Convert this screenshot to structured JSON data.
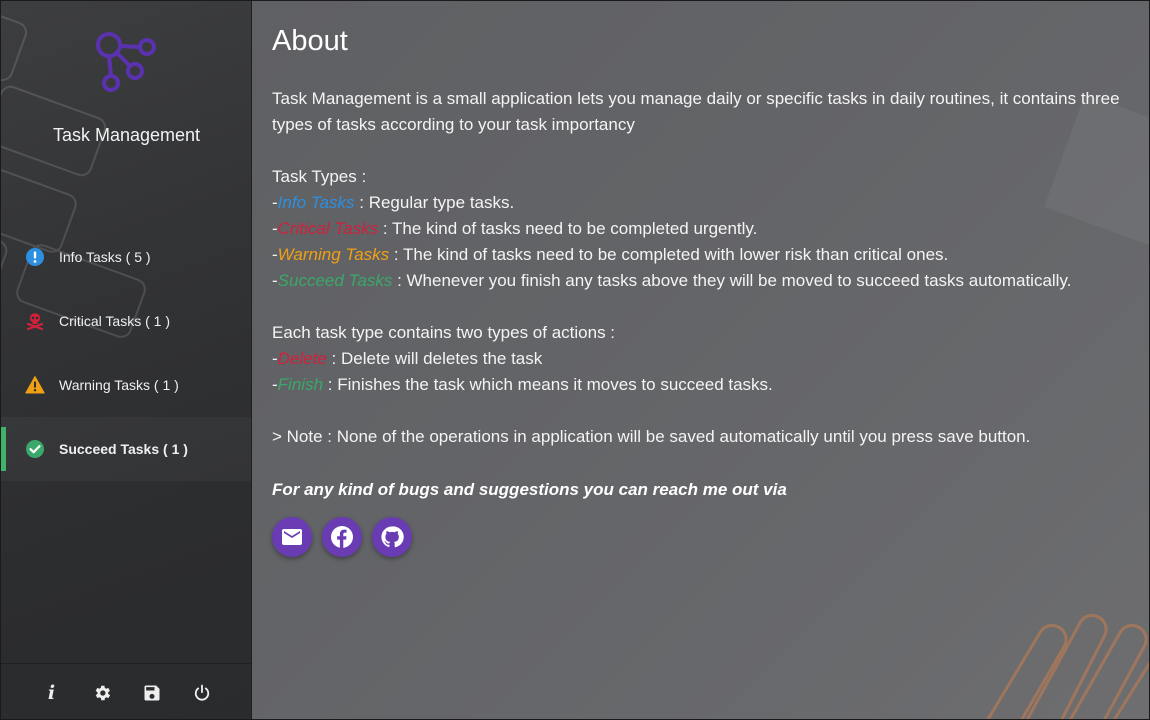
{
  "app": {
    "title": "Task Management"
  },
  "nav": {
    "items": [
      {
        "label": "Info Tasks ( 5 )",
        "icon": "info-circle-icon",
        "color": "#2d8fe0",
        "active": false
      },
      {
        "label": "Critical Tasks ( 1 )",
        "icon": "skull-crossbones-icon",
        "color": "#d0213d",
        "active": false
      },
      {
        "label": "Warning Tasks ( 1 )",
        "icon": "warning-triangle-icon",
        "color": "#f0a015",
        "active": false
      },
      {
        "label": "Succeed Tasks ( 1 )",
        "icon": "check-circle-icon",
        "color": "#3aa86a",
        "active": true
      }
    ]
  },
  "footer": {
    "buttons": [
      {
        "name": "about",
        "icon": "info-italic-icon",
        "glyph": "i"
      },
      {
        "name": "settings",
        "icon": "gear-icon"
      },
      {
        "name": "save",
        "icon": "save-icon"
      },
      {
        "name": "power",
        "icon": "power-icon"
      }
    ]
  },
  "main": {
    "title": "About",
    "intro_line1": "Task Management is a small application lets you manage daily or specific tasks in daily routines, it contains three",
    "intro_line2": "types of tasks according to your task importancy",
    "types_heading": "Task Types :",
    "types": [
      {
        "prefix": "-",
        "name": "Info Tasks",
        "desc": " : Regular type tasks."
      },
      {
        "prefix": "-",
        "name": "Critical Tasks",
        "desc": " : The kind of tasks need to be completed urgently."
      },
      {
        "prefix": "-",
        "name": "Warning Tasks",
        "desc": " : The kind of tasks need to be completed with lower risk than critical ones."
      },
      {
        "prefix": "-",
        "name": "Succeed Tasks",
        "desc": " : Whenever you finish any tasks above they will be moved to succeed tasks automatically."
      }
    ],
    "actions_heading": "Each task type contains two types of actions :",
    "actions": [
      {
        "prefix": "-",
        "name": "Delete",
        "desc": " : Delete will deletes the task"
      },
      {
        "prefix": "-",
        "name": "Finish",
        "desc": " : Finishes the task which means it moves to succeed tasks."
      }
    ],
    "note": "> Note : None of the operations in application will be saved automatically until you press save button.",
    "contact_text": "For any kind of bugs and suggestions you can reach me out via",
    "social": [
      {
        "name": "email",
        "icon": "email-icon"
      },
      {
        "name": "facebook",
        "icon": "facebook-icon"
      },
      {
        "name": "github",
        "icon": "github-icon"
      }
    ]
  },
  "colors": {
    "info": "#2d8fe0",
    "critical": "#d0213d",
    "warning": "#f0a015",
    "success": "#3aa86a",
    "accent": "#6a3cb3",
    "logo": "#5a32b0"
  }
}
